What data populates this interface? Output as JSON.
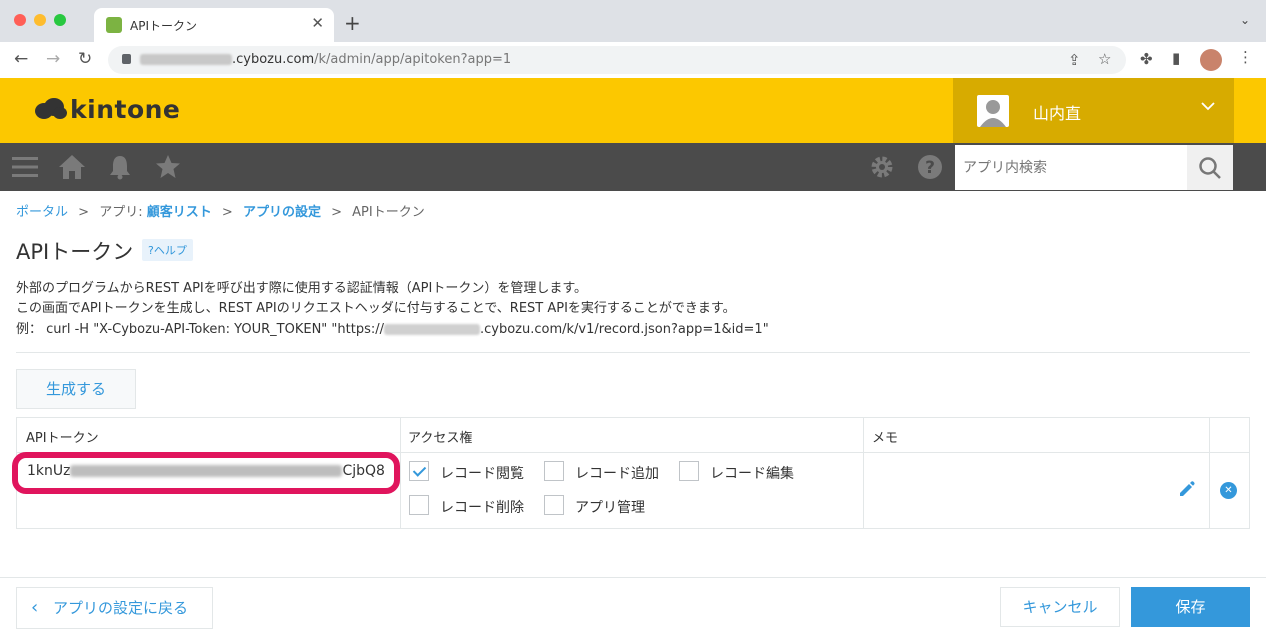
{
  "browser": {
    "tab_title": "APIトークン",
    "url_domain": ".cybozu.com",
    "url_path": "/k/admin/app/apitoken?app=1"
  },
  "header": {
    "logo_text": "kintone",
    "user_name": "山内直"
  },
  "nav": {
    "search_placeholder": "アプリ内検索"
  },
  "breadcrumb": {
    "portal": "ポータル",
    "sep": ">",
    "app_prefix": "アプリ:",
    "app_name": "顧客リスト",
    "settings": "アプリの設定",
    "current": "APIトークン"
  },
  "page": {
    "title": "APIトークン",
    "help": "?ヘルプ",
    "desc_line1": "外部のプログラムからREST APIを呼び出す際に使用する認証情報（APIトークン）を管理します。",
    "desc_line2": "この画面でAPIトークンを生成し、REST APIのリクエストヘッダに付与することで、REST APIを実行することができます。",
    "desc_line3_pre": "例：  curl -H \"X-Cybozu-API-Token: YOUR_TOKEN\" \"https://",
    "desc_line3_post": ".cybozu.com/k/v1/record.json?app=1&id=1\"",
    "generate_button": "生成する"
  },
  "table": {
    "headers": [
      "APIトークン",
      "アクセス権",
      "メモ"
    ],
    "token_prefix": "1knUz",
    "token_suffix": "CjbQ8",
    "permissions": [
      {
        "label": "レコード閲覧",
        "checked": true
      },
      {
        "label": "レコード追加",
        "checked": false
      },
      {
        "label": "レコード編集",
        "checked": false
      },
      {
        "label": "レコード削除",
        "checked": false
      },
      {
        "label": "アプリ管理",
        "checked": false
      }
    ],
    "memo": ""
  },
  "footer": {
    "back_button": "アプリの設定に戻る",
    "cancel_button": "キャンセル",
    "save_button": "保存"
  },
  "colors": {
    "brand_yellow": "#fcc800",
    "user_box": "#d7ab00",
    "nav_bg": "#4b4b4b",
    "accent_blue": "#3498db",
    "highlight_pink": "#e0155d"
  }
}
